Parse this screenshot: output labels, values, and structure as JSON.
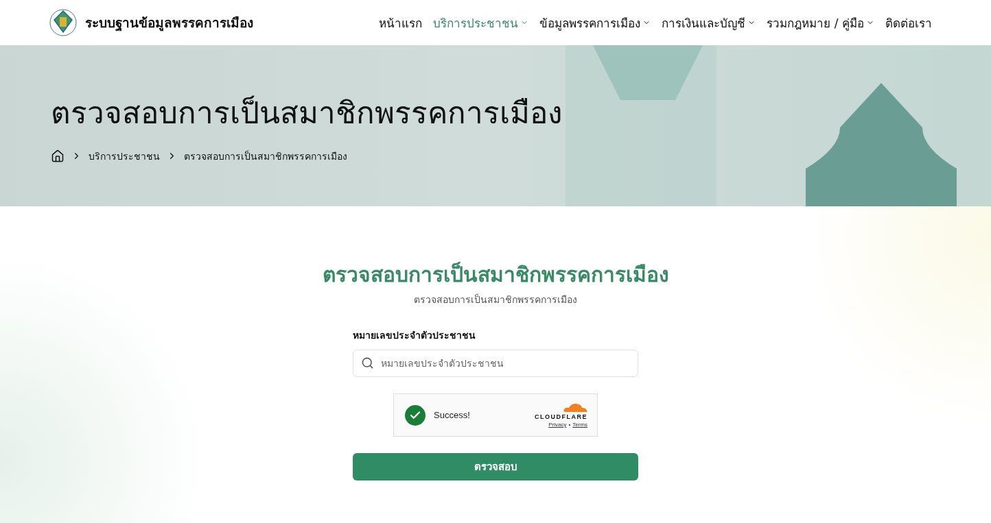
{
  "header": {
    "site_title": "ระบบฐานข้อมูลพรรคการเมือง"
  },
  "nav": [
    {
      "label": "หน้าแรก",
      "selected": false,
      "dropdown": false
    },
    {
      "label": "บริการประชาชน",
      "selected": true,
      "dropdown": true
    },
    {
      "label": "ข้อมูลพรรคการเมือง",
      "selected": false,
      "dropdown": true
    },
    {
      "label": "การเงินและบัญชี",
      "selected": false,
      "dropdown": true
    },
    {
      "label": "รวมกฎหมาย / คู่มือ",
      "selected": false,
      "dropdown": true
    },
    {
      "label": "ติดต่อเรา",
      "selected": false,
      "dropdown": false
    }
  ],
  "hero": {
    "title": "ตรวจสอบการเป็นสมาชิกพรรคการเมือง",
    "breadcrumb": [
      "บริการประชาชน",
      "ตรวจสอบการเป็นสมาชิกพรรคการเมือง"
    ]
  },
  "form": {
    "title": "ตรวจสอบการเป็นสมาชิกพรรคการเมือง",
    "subtitle": "ตรวจสอบการเป็นสมาชิกพรรคการเมือง",
    "field_label": "หมายเลขประจำตัวประชาชน",
    "placeholder": "หมายเลขประจำตัวประชาชน",
    "captcha": {
      "status": "Success!",
      "verified": true,
      "brand": "CLOUDFLARE",
      "links": [
        "Privacy",
        "Terms"
      ],
      "separator": "•"
    },
    "submit": "ตรวจสอบ"
  }
}
